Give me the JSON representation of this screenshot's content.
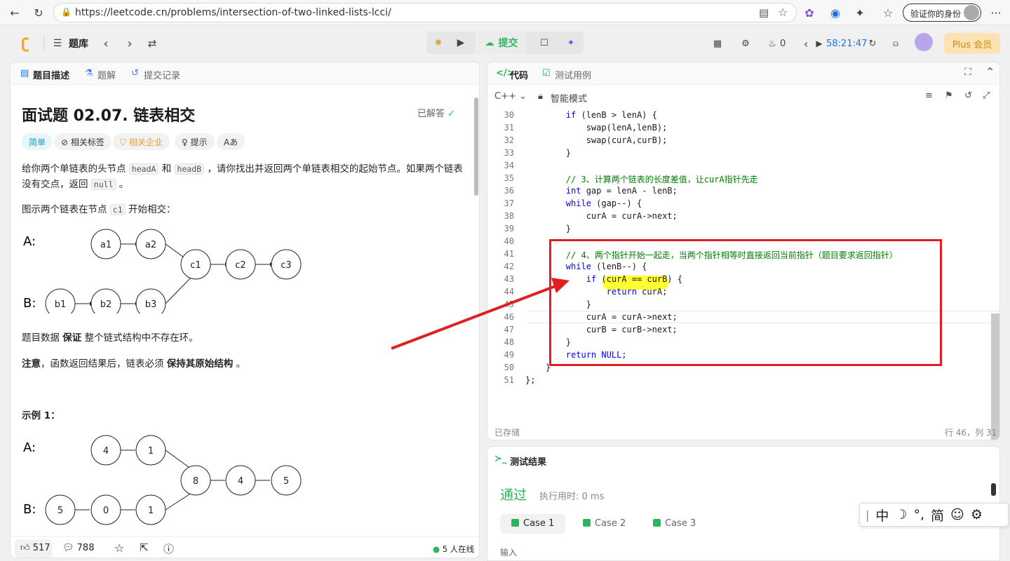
{
  "browser": {
    "url": "https://leetcode.cn/problems/intersection-of-two-linked-lists-lcci/",
    "profile_label": "验证你的身份",
    "more_label": "···"
  },
  "toolbar": {
    "problem_bank": "题库",
    "submit": "提交",
    "streak": "0",
    "timer": "58:21:47",
    "plus": "Plus 会员"
  },
  "left": {
    "tabs": [
      "题目描述",
      "题解",
      "提交记录"
    ],
    "title": "面试题 02.07. 链表相交",
    "solved": "已解答",
    "chips": [
      "简单",
      "相关标签",
      "相关企业",
      "提示",
      "Aあ"
    ],
    "para1_a": "给你两个单链表的头节点",
    "para1_code1": "headA",
    "para1_b": "和",
    "para1_code2": "headB",
    "para1_c": "，请你找出并返回两个单链表相交的起始节点。如果两个链表没有交点，返回",
    "para1_code3": "null",
    "para1_d": "。",
    "para2_a": "图示两个链表在节点",
    "para2_code": "c1",
    "para2_b": "开始相交：",
    "diagram1": {
      "rowA": "A:",
      "rowB": "B:",
      "nodes": [
        "a1",
        "a2",
        "c1",
        "c2",
        "c3",
        "b1",
        "b2",
        "b3"
      ]
    },
    "para3_a": "题目数据",
    "para3_b": "保证",
    "para3_c": "整个链式结构中不存在环。",
    "para4_a": "注意",
    "para4_b": "，函数返回结果后，链表必须",
    "para4_c": "保持其原始结构",
    "para4_d": "。",
    "example_title": "示例 1：",
    "diagram2": {
      "rowA": "A:",
      "rowB": "B:",
      "nodes": [
        "4",
        "1",
        "8",
        "4",
        "5",
        "5",
        "0",
        "1"
      ]
    },
    "likes": "517",
    "comments": "788",
    "online": "5 人在线"
  },
  "right": {
    "tabs": [
      "代码",
      "测试用例"
    ],
    "language": "C++",
    "mode": "智能模式",
    "lines": [
      {
        "n": "30",
        "code": "        if (lenB > lenA) {"
      },
      {
        "n": "31",
        "code": "            swap(lenA,lenB);"
      },
      {
        "n": "32",
        "code": "            swap(curA,curB);"
      },
      {
        "n": "33",
        "code": "        }"
      },
      {
        "n": "34",
        "code": ""
      },
      {
        "n": "35",
        "code": "        // 3、计算两个链表的长度差值，让curA指针先走"
      },
      {
        "n": "36",
        "code": "        int gap = lenA - lenB;"
      },
      {
        "n": "37",
        "code": "        while (gap--) {"
      },
      {
        "n": "38",
        "code": "            curA = curA->next;"
      },
      {
        "n": "39",
        "code": "        }"
      },
      {
        "n": "40",
        "code": ""
      },
      {
        "n": "41",
        "code": "        // 4、两个指针开始一起走，当两个指针相等时直接返回当前指针（题目要求返回指针）"
      },
      {
        "n": "42",
        "code": "        while (lenB--) {"
      },
      {
        "n": "43",
        "code": "            if (curA == curB) {"
      },
      {
        "n": "44",
        "code": "                return curA;"
      },
      {
        "n": "45",
        "code": "            }"
      },
      {
        "n": "46",
        "code": "            curA = curA->next;"
      },
      {
        "n": "47",
        "code": "            curB = curB->next;"
      },
      {
        "n": "48",
        "code": "        }"
      },
      {
        "n": "49",
        "code": "        return NULL;"
      },
      {
        "n": "50",
        "code": "    }"
      },
      {
        "n": "51",
        "code": "};"
      }
    ],
    "saved": "已存储",
    "cursor_pos": "行 46，列 31"
  },
  "result": {
    "title": "测试结果",
    "status": "通过",
    "exec_time": "执行用时: 0 ms",
    "cases": [
      "Case 1",
      "Case 2",
      "Case 3"
    ],
    "input_label": "输入"
  },
  "ime": {
    "items": [
      "中",
      "☽",
      "°,",
      "简",
      "☺",
      "⚙"
    ]
  },
  "colors": {
    "accent_green": "#2db55d",
    "annotation_red": "#e02020",
    "highlight_yellow": "#ffff33"
  }
}
